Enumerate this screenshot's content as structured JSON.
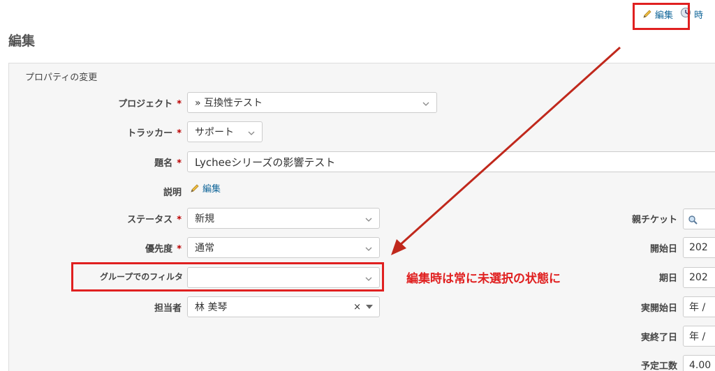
{
  "header": {
    "edit_label": "編集",
    "time_label": "時"
  },
  "page": {
    "title": "編集"
  },
  "form": {
    "legend": "プロパティの変更",
    "project": {
      "label": "プロジェクト",
      "value": "» 互換性テスト"
    },
    "tracker": {
      "label": "トラッカー",
      "value": "サポート"
    },
    "subject": {
      "label": "題名",
      "value": "Lycheeシリーズの影響テスト"
    },
    "description": {
      "label": "説明",
      "edit_label": "編集"
    },
    "status": {
      "label": "ステータス",
      "value": "新規"
    },
    "priority": {
      "label": "優先度",
      "value": "通常"
    },
    "group_filter": {
      "label": "グループでのフィルタ",
      "value": ""
    },
    "assignee": {
      "label": "担当者",
      "value": "林 美琴",
      "clear": "×"
    },
    "required_mark": "*"
  },
  "right_form": {
    "parent": {
      "label": "親チケット"
    },
    "start_date": {
      "label": "開始日",
      "value": "202"
    },
    "due_date": {
      "label": "期日",
      "value": "202"
    },
    "actual_start": {
      "label": "実開始日",
      "value": "年 /"
    },
    "actual_end": {
      "label": "実終了日",
      "value": "年 /"
    },
    "estimated": {
      "label": "予定工数",
      "value": "4.00"
    }
  },
  "annotation": {
    "text": "編集時は常に未選択の状態に",
    "color": "#e02020"
  }
}
